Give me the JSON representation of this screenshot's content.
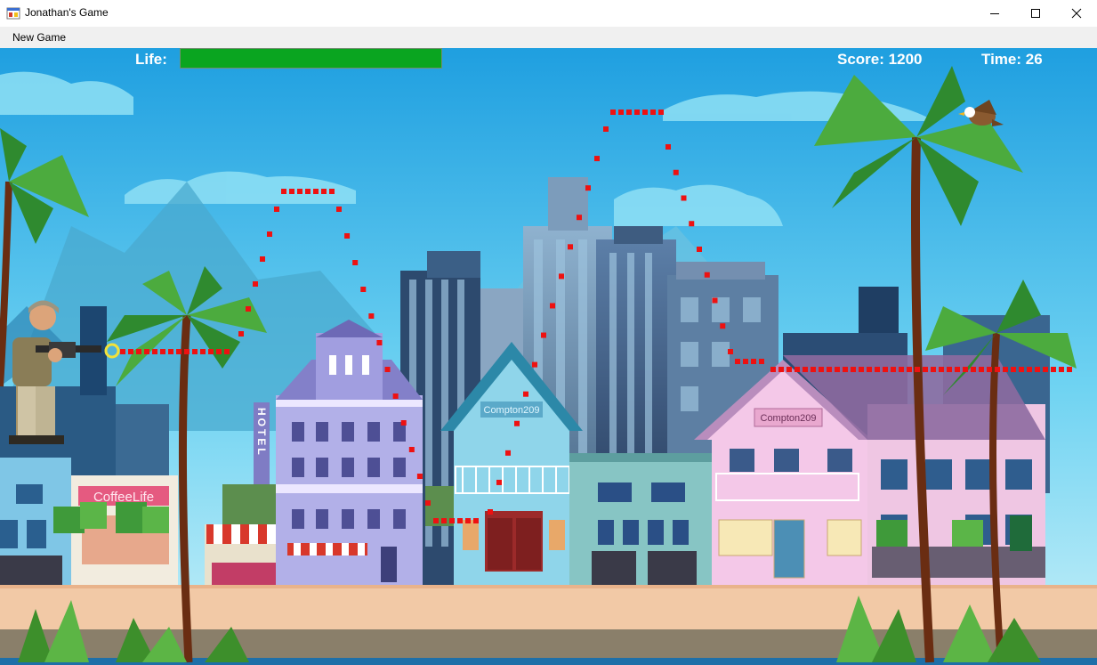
{
  "window": {
    "title": "Jonathan's Game",
    "controls": [
      "minimize-icon",
      "maximize-icon",
      "close-icon"
    ]
  },
  "menu": {
    "items": [
      {
        "label": "New Game"
      }
    ]
  },
  "hud": {
    "life_label": "Life:",
    "life_fraction": 1.0,
    "life_color": "#0aa520",
    "score_label": "Score:",
    "score_value": "1200",
    "time_label": "Time:",
    "time_value": "26"
  },
  "scene": {
    "sprites": [
      "soldier-sprite",
      "eagle-sprite",
      "crosshair-icon"
    ],
    "projectile_color": "#ee1111",
    "sky_color": "#2fb1e6",
    "ground_color": "#f2c9a6",
    "signs": {
      "hotel": "HOTEL",
      "cafe": "CoffeeLife",
      "blue_house": "Compton209",
      "pink_house": "Compton209"
    }
  }
}
